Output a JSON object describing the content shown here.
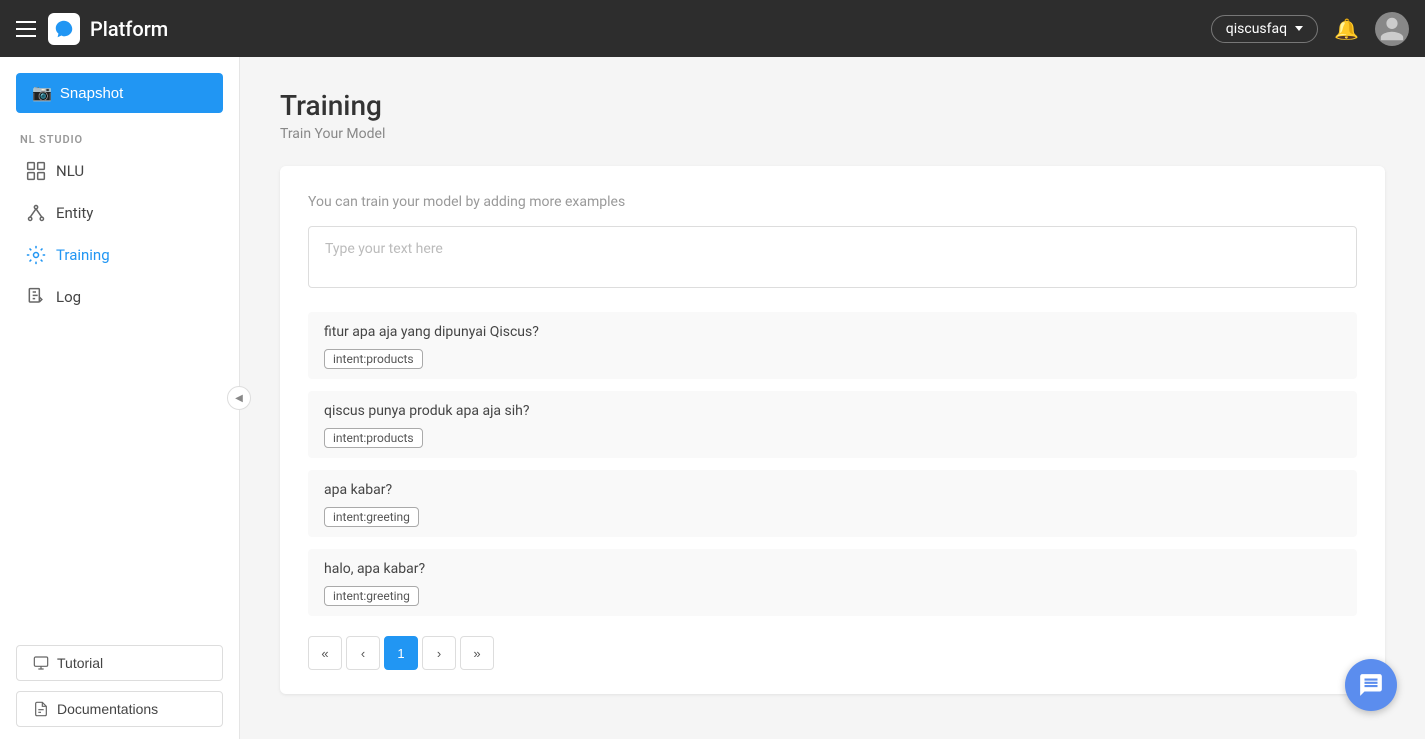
{
  "topnav": {
    "title": "Platform",
    "user": "qiscusfaq"
  },
  "sidebar": {
    "snapshot_label": "Snapshot",
    "section_label": "NL STUDIO",
    "items": [
      {
        "id": "nlu",
        "label": "NLU",
        "icon": "layers"
      },
      {
        "id": "entity",
        "label": "Entity",
        "icon": "entity"
      },
      {
        "id": "training",
        "label": "Training",
        "icon": "training",
        "active": true
      },
      {
        "id": "log",
        "label": "Log",
        "icon": "log"
      }
    ],
    "tutorial_label": "Tutorial",
    "docs_label": "Documentations"
  },
  "page": {
    "title": "Training",
    "subtitle": "Train Your Model",
    "hint": "You can train your model by adding more examples",
    "input_placeholder": "Type your text here"
  },
  "examples": [
    {
      "text": "fitur apa aja yang dipunyai Qiscus?",
      "intent": "intent:products"
    },
    {
      "text": "qiscus punya produk apa aja sih?",
      "intent": "intent:products"
    },
    {
      "text": "apa kabar?",
      "intent": "intent:greeting"
    },
    {
      "text": "halo, apa kabar?",
      "intent": "intent:greeting"
    }
  ],
  "pagination": {
    "first": "«",
    "prev": "‹",
    "current": "1",
    "next": "›",
    "last": "»"
  }
}
